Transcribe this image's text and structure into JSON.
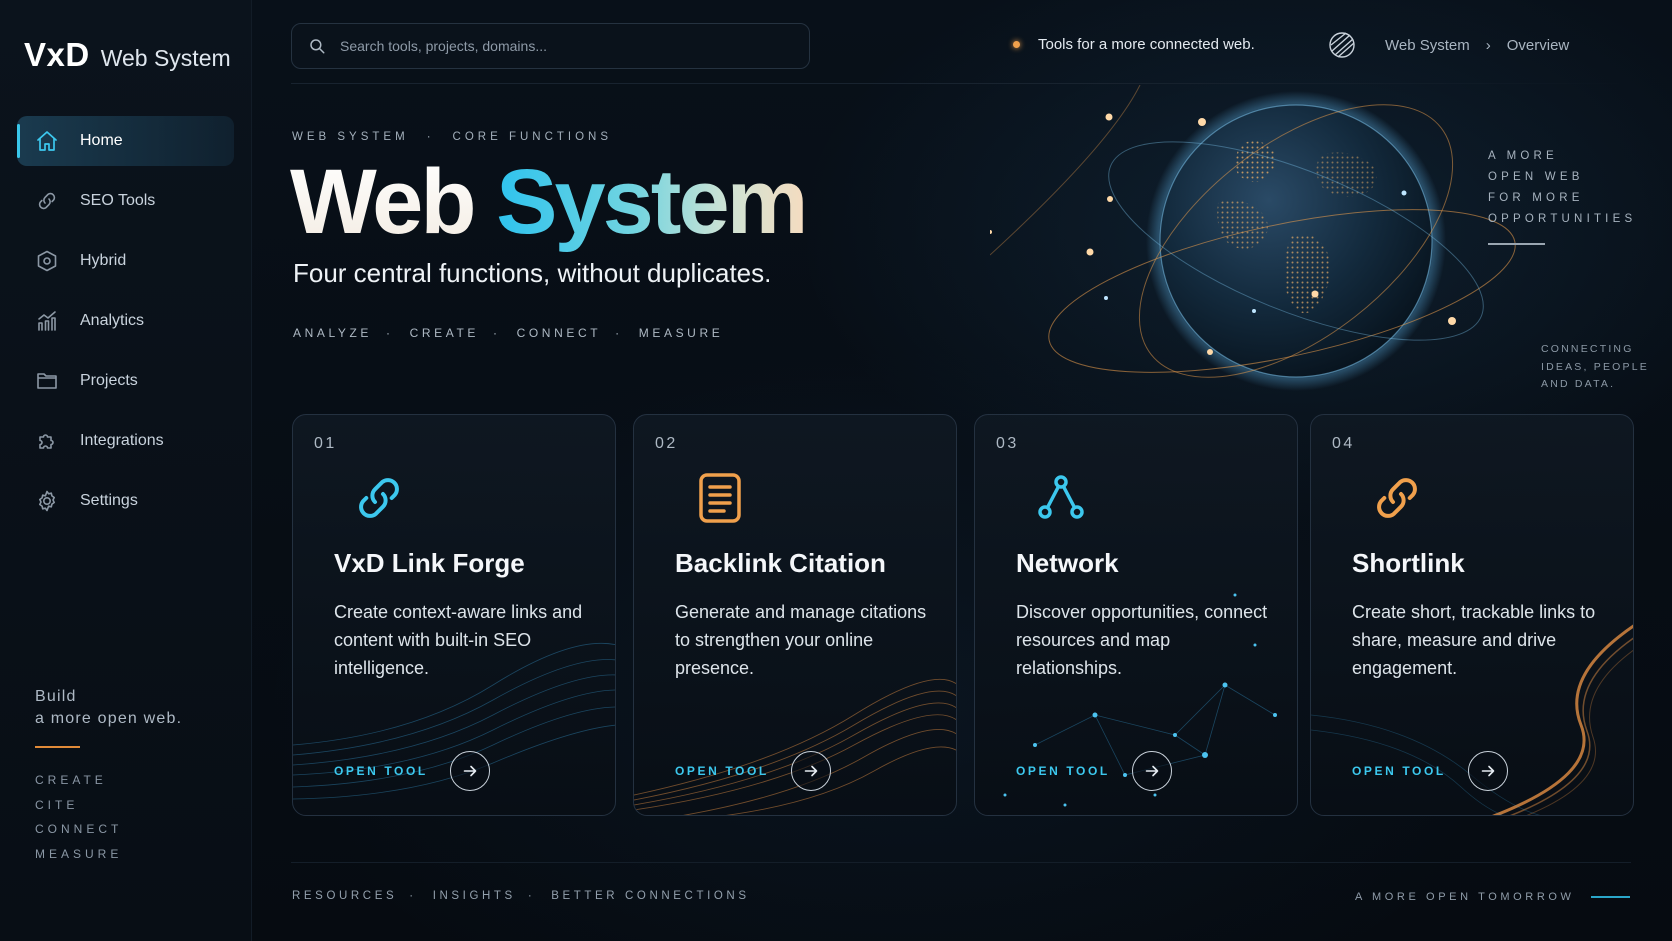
{
  "app": {
    "brand_mark": "VxD",
    "brand_name": "Web System"
  },
  "sidebar": {
    "items": [
      {
        "label": "Home",
        "icon": "home-icon",
        "active": true
      },
      {
        "label": "SEO Tools",
        "icon": "link-icon"
      },
      {
        "label": "Hybrid",
        "icon": "hexagon-icon"
      },
      {
        "label": "Analytics",
        "icon": "bar-chart-icon"
      },
      {
        "label": "Projects",
        "icon": "folder-icon"
      },
      {
        "label": "Integrations",
        "icon": "puzzle-icon"
      },
      {
        "label": "Settings",
        "icon": "gear-icon"
      }
    ],
    "footer": {
      "line1": "Build",
      "line2": "a more open web.",
      "keywords": [
        "CREATE",
        "CITE",
        "CONNECT",
        "MEASURE"
      ]
    }
  },
  "topbar": {
    "search_placeholder": "Search tools, projects, domains...",
    "tagline": "Tools for a more connected web.",
    "breadcrumb": [
      "Web System",
      "Overview"
    ]
  },
  "hero": {
    "eyebrow": [
      "WEB SYSTEM",
      "CORE FUNCTIONS"
    ],
    "title_part1": "Web",
    "title_part2": "System",
    "subtitle": "Four central functions, without duplicates.",
    "keywords": [
      "ANALYZE",
      "CREATE",
      "CONNECT",
      "MEASURE"
    ],
    "side_note": [
      "A MORE",
      "OPEN WEB",
      "FOR MORE",
      "OPPORTUNITIES"
    ],
    "side_note2": [
      "CONNECTING",
      "IDEAS, PEOPLE",
      "AND DATA."
    ]
  },
  "cards": [
    {
      "number": "01",
      "title": "VxD Link Forge",
      "description": "Create context-aware links and content with built-in SEO intelligence.",
      "cta": "OPEN TOOL",
      "icon": "link-icon",
      "accent": "#3cc8ee"
    },
    {
      "number": "02",
      "title": "Backlink Citation",
      "description": "Generate and manage citations to strengthen your online presence.",
      "cta": "OPEN TOOL",
      "icon": "document-icon",
      "accent": "#f0a04c"
    },
    {
      "number": "03",
      "title": "Network",
      "description": "Discover opportunities, connect resources and map relationships.",
      "cta": "OPEN TOOL",
      "icon": "network-icon",
      "accent": "#3cc8ee"
    },
    {
      "number": "04",
      "title": "Shortlink",
      "description": "Create short, trackable links to share, measure and drive engagement.",
      "cta": "OPEN TOOL",
      "icon": "link-icon",
      "accent": "#f0a04c"
    }
  ],
  "footer": {
    "links": [
      "RESOURCES",
      "INSIGHTS",
      "BETTER CONNECTIONS"
    ],
    "right_text": "A MORE OPEN TOMORROW"
  },
  "colors": {
    "accent_cyan": "#3cc8ee",
    "accent_orange": "#f0a04c",
    "background": "#070c12"
  }
}
